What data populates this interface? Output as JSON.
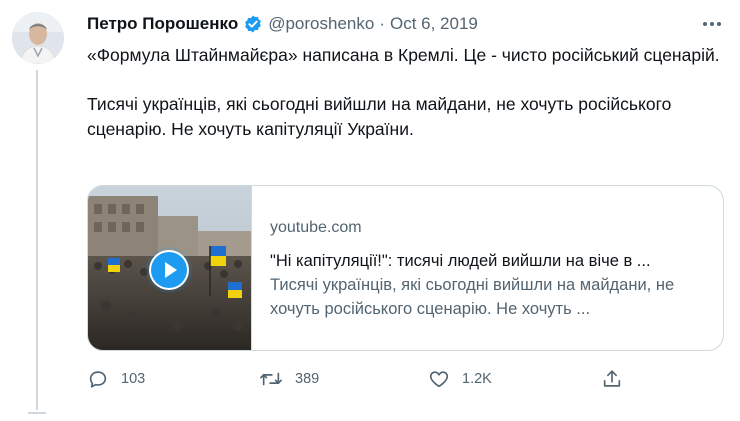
{
  "tweet": {
    "author_name": "Петро Порошенко",
    "handle": "@poroshenko",
    "separator": "·",
    "date": "Oct 6, 2019",
    "paragraphs": [
      "«Формула Штайнмайєра» написана в Кремлі. Це - чисто російський сценарій.",
      "Тисячі українців, які сьогодні вийшли на майдани, не хочуть російського сценарію. Не хочуть капітуляції України."
    ]
  },
  "card": {
    "domain": "youtube.com",
    "title": "\"Ні капітуляції!\": тисячі людей вийшли на віче в ...",
    "description": "Тисячі українців, які сьогодні вийшли на майдани, не хочуть російського сценарію. Не хочуть ..."
  },
  "actions": {
    "replies": "103",
    "retweets": "389",
    "likes": "1.2K"
  },
  "colors": {
    "text_primary": "#0f1419",
    "text_secondary": "#536471",
    "border": "#cfd9de",
    "verified": "#1d9bf0"
  },
  "icons": {
    "verified": "verified-badge-icon",
    "more": "more-dots-icon",
    "reply": "reply-icon",
    "retweet": "retweet-icon",
    "like": "heart-icon",
    "share": "share-icon",
    "play": "play-icon"
  }
}
